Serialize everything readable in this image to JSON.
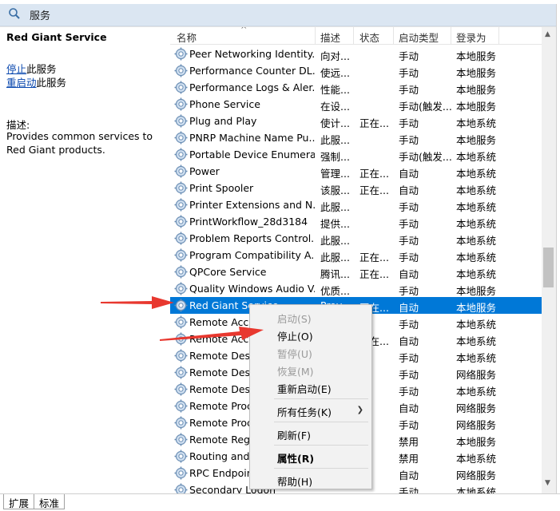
{
  "window": {
    "title": "服务"
  },
  "left_panel": {
    "service_title": "Red Giant Service",
    "stop_link": "停止",
    "stop_suffix": "此服务",
    "restart_link": "重启动",
    "restart_suffix": "此服务",
    "desc_label": "描述:",
    "desc_text": "Provides common services to Red Giant products."
  },
  "columns": {
    "name": "名称",
    "desc": "描述",
    "state": "状态",
    "startup": "启动类型",
    "logon": "登录为"
  },
  "rows": [
    {
      "name": "Peer Networking Identity...",
      "desc": "向对...",
      "state": "",
      "startup": "手动",
      "logon": "本地服务"
    },
    {
      "name": "Performance Counter DL...",
      "desc": "使远...",
      "state": "",
      "startup": "手动",
      "logon": "本地服务"
    },
    {
      "name": "Performance Logs & Aler...",
      "desc": "性能...",
      "state": "",
      "startup": "手动",
      "logon": "本地服务"
    },
    {
      "name": "Phone Service",
      "desc": "在设...",
      "state": "",
      "startup": "手动(触发...",
      "logon": "本地服务"
    },
    {
      "name": "Plug and Play",
      "desc": "使计...",
      "state": "正在...",
      "startup": "手动",
      "logon": "本地系统"
    },
    {
      "name": "PNRP Machine Name Pu...",
      "desc": "此服...",
      "state": "",
      "startup": "手动",
      "logon": "本地服务"
    },
    {
      "name": "Portable Device Enumera...",
      "desc": "强制...",
      "state": "",
      "startup": "手动(触发...",
      "logon": "本地系统"
    },
    {
      "name": "Power",
      "desc": "管理...",
      "state": "正在...",
      "startup": "自动",
      "logon": "本地系统"
    },
    {
      "name": "Print Spooler",
      "desc": "该服...",
      "state": "正在...",
      "startup": "自动",
      "logon": "本地系统"
    },
    {
      "name": "Printer Extensions and N...",
      "desc": "此服...",
      "state": "",
      "startup": "手动",
      "logon": "本地系统"
    },
    {
      "name": "PrintWorkflow_28d3184",
      "desc": "提供...",
      "state": "",
      "startup": "手动",
      "logon": "本地系统"
    },
    {
      "name": "Problem Reports Control...",
      "desc": "此服...",
      "state": "",
      "startup": "手动",
      "logon": "本地系统"
    },
    {
      "name": "Program Compatibility A...",
      "desc": "此服...",
      "state": "正在...",
      "startup": "手动",
      "logon": "本地系统"
    },
    {
      "name": "QPCore Service",
      "desc": "腾讯...",
      "state": "正在...",
      "startup": "自动",
      "logon": "本地系统"
    },
    {
      "name": "Quality Windows Audio V...",
      "desc": "优质...",
      "state": "",
      "startup": "手动",
      "logon": "本地服务"
    },
    {
      "name": "Red Giant Service",
      "desc": "Prov...",
      "state": "正在...",
      "startup": "自动",
      "logon": "本地服务"
    },
    {
      "name": "Remote Access Auto Con...",
      "desc": "",
      "state": "",
      "startup": "手动",
      "logon": "本地系统"
    },
    {
      "name": "Remote Access Connecti...",
      "desc": "",
      "state": "正在...",
      "startup": "自动",
      "logon": "本地系统"
    },
    {
      "name": "Remote Desktop Configu...",
      "desc": "",
      "state": "",
      "startup": "手动",
      "logon": "本地系统"
    },
    {
      "name": "Remote Desktop Services",
      "desc": "",
      "state": "",
      "startup": "手动",
      "logon": "网络服务"
    },
    {
      "name": "Remote Desktop Services...",
      "desc": "",
      "state": "",
      "startup": "手动",
      "logon": "本地系统"
    },
    {
      "name": "Remote Procedure Call (...",
      "desc": "",
      "state": "",
      "startup": "自动",
      "logon": "网络服务"
    },
    {
      "name": "Remote Procedure Call (...",
      "desc": "",
      "state": "",
      "startup": "手动",
      "logon": "网络服务"
    },
    {
      "name": "Remote Registry",
      "desc": "",
      "state": "",
      "startup": "禁用",
      "logon": "本地服务"
    },
    {
      "name": "Routing and Remote Acc...",
      "desc": "",
      "state": "",
      "startup": "禁用",
      "logon": "本地系统"
    },
    {
      "name": "RPC Endpoint Mapper",
      "desc": "",
      "state": "",
      "startup": "自动",
      "logon": "网络服务"
    },
    {
      "name": "Secondary Logon",
      "desc": "",
      "state": "",
      "startup": "手动",
      "logon": "本地系统"
    }
  ],
  "context_menu": {
    "start": "启动(S)",
    "stop": "停止(O)",
    "pause": "暂停(U)",
    "resume": "恢复(M)",
    "restart": "重新启动(E)",
    "all_tasks": "所有任务(K)",
    "refresh": "刷新(F)",
    "properties": "属性(R)",
    "help": "帮助(H)"
  },
  "tabs": {
    "extended": "扩展",
    "standard": "标准"
  },
  "colors": {
    "selection": "#0078d7",
    "link": "#0645ad",
    "arrow": "#e8382f"
  },
  "icons": {
    "title": "gear-icon",
    "service": "service-gear-icon",
    "submenu": "chevron-right-icon"
  }
}
